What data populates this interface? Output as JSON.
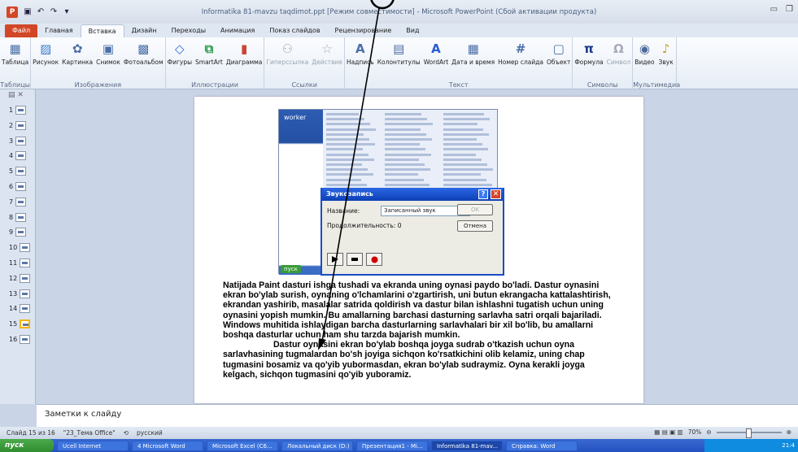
{
  "title": "Informatika 81-mavzu taqdimot.ppt [Режим совместимости] - Microsoft PowerPoint (Сбой активации продукта)",
  "app_icon": "P",
  "tabs": [
    "Файл",
    "Главная",
    "Вставка",
    "Дизайн",
    "Переходы",
    "Анимация",
    "Показ слайдов",
    "Рецензирование",
    "Вид"
  ],
  "ribbon": {
    "groups": [
      {
        "label": "Таблицы",
        "buttons": [
          {
            "label": "Таблица",
            "icon": "table-icon"
          }
        ]
      },
      {
        "label": "Изображения",
        "buttons": [
          {
            "label": "Рисунок",
            "icon": "picture-icon"
          },
          {
            "label": "Картинка",
            "icon": "clipart-icon"
          },
          {
            "label": "Снимок",
            "icon": "screenshot-icon"
          },
          {
            "label": "Фотоальбом",
            "icon": "photo-album-icon"
          }
        ]
      },
      {
        "label": "Иллюстрации",
        "buttons": [
          {
            "label": "Фигуры",
            "icon": "shapes-icon"
          },
          {
            "label": "SmartArt",
            "icon": "smartart-icon"
          },
          {
            "label": "Диаграмма",
            "icon": "chart-icon"
          }
        ]
      },
      {
        "label": "Ссылки",
        "buttons": [
          {
            "label": "Гиперссылка",
            "icon": "hyperlink-icon",
            "dim": true
          },
          {
            "label": "Действие",
            "icon": "action-icon",
            "dim": true
          }
        ]
      },
      {
        "label": "Текст",
        "buttons": [
          {
            "label": "Надпись",
            "icon": "textbox-icon"
          },
          {
            "label": "Колонтитулы",
            "icon": "header-footer-icon"
          },
          {
            "label": "WordArt",
            "icon": "wordart-icon"
          },
          {
            "label": "Дата и время",
            "icon": "date-time-icon"
          },
          {
            "label": "Номер слайда",
            "icon": "slide-number-icon"
          },
          {
            "label": "Объект",
            "icon": "object-icon"
          }
        ]
      },
      {
        "label": "Символы",
        "buttons": [
          {
            "label": "Формула",
            "icon": "formula-icon"
          },
          {
            "label": "Символ",
            "icon": "symbol-icon",
            "dim": true
          }
        ]
      },
      {
        "label": "Мультимедиа",
        "buttons": [
          {
            "label": "Видео",
            "icon": "video-icon"
          },
          {
            "label": "Звук",
            "icon": "audio-icon"
          }
        ]
      }
    ]
  },
  "slides": [
    "1",
    "2",
    "3",
    "4",
    "5",
    "6",
    "7",
    "8",
    "9",
    "10",
    "11",
    "12",
    "13",
    "14",
    "15",
    "16"
  ],
  "selected_slide": "15",
  "dialog": {
    "title": "Звукозапись",
    "name_label": "Название:",
    "name_value": "Записанный звук",
    "duration_label": "Продолжительность:",
    "duration_value": "0",
    "ok": "OK",
    "cancel": "Отмена"
  },
  "menu_user": "worker",
  "start_label": "пуск",
  "body": {
    "p1": "Natijada Paint dasturi ishga tushadi va ekranda uning oynasi paydo bo'ladi. Dastur oynasini ekran bo'ylab surish, oynaning o'lchamlarini o'zgartirish, uni butun ekrangacha kattalashtirish, ekrandan yashirib, masalalar satrida qoldirish va dastur bilan ishlashni tugatish uchun uning oynasini yopish mumkin. Bu amallarning barchasi dasturning sarlavha satri orqali bajariladi. Windows muhitida ishlaydigan barcha dasturlarning sarlavhalari bir xil bo'lib, bu amallarni boshqa dasturlar uchun ham shu tarzda bajarish mumkin.",
    "p2": "Dastur oynasini ekran bo'ylab boshqa joyga sudrab o'tkazish uchun oyna sarlavhasining tugmalardan bo'sh joyiga sichqon ko'rsatkichini olib kelamiz, uning chap tugmasini bosamiz va qo'yib yubormasdan, ekran bo'ylab sudraymiz. Oyna kerakli joyga kelgach, sichqon tugmasini qo'yib yuboramiz."
  },
  "notes_placeholder": "Заметки к слайду",
  "status": {
    "slide": "Слайд 15 из 16",
    "theme": "\"23_Тема Office\"",
    "lang": "русский",
    "zoom": "70%"
  },
  "taskbar": {
    "start": "пуск",
    "tasks": [
      "Ucell Internet",
      "4 Microsoft Word",
      "Microsoft Excel (C6...",
      "Локальный диск (D:)",
      "Презентация1 - Mi...",
      "Informatika 81-mav...",
      "Справка: Word"
    ],
    "active_task": 5,
    "clock": "21:4"
  },
  "colors": {
    "accent": "#d24726",
    "titlebar": "#2a66e4",
    "taskbar": "#2352c0"
  }
}
